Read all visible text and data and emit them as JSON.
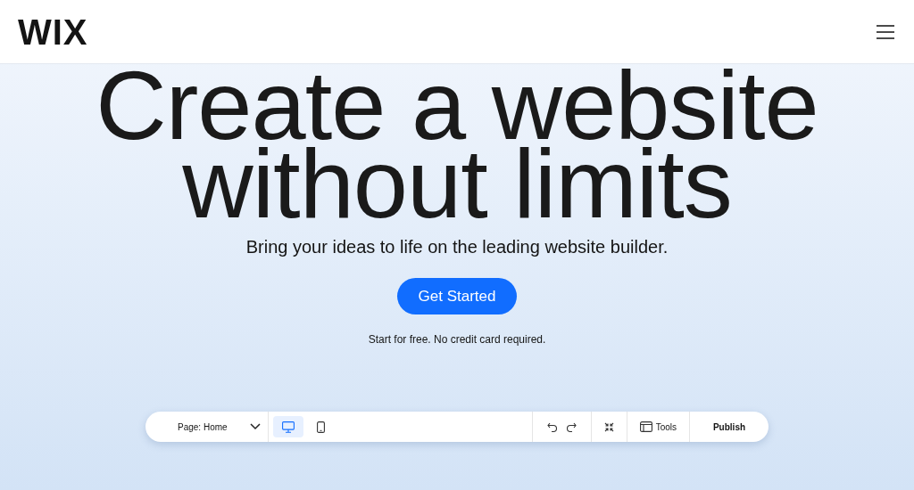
{
  "header": {
    "logo": "WIX"
  },
  "hero": {
    "headline": [
      "Create a website",
      "without limits"
    ],
    "subtitle": "Bring your ideas to life on the leading website builder.",
    "cta": "Get Started",
    "note": "Start for free. No credit card required."
  },
  "editor_toolbar": {
    "page_select": "Page: Home",
    "devices": [
      {
        "kind": "desktop",
        "selected": true
      },
      {
        "kind": "mobile",
        "selected": false
      }
    ],
    "tools": "Tools",
    "publish": "Publish"
  }
}
